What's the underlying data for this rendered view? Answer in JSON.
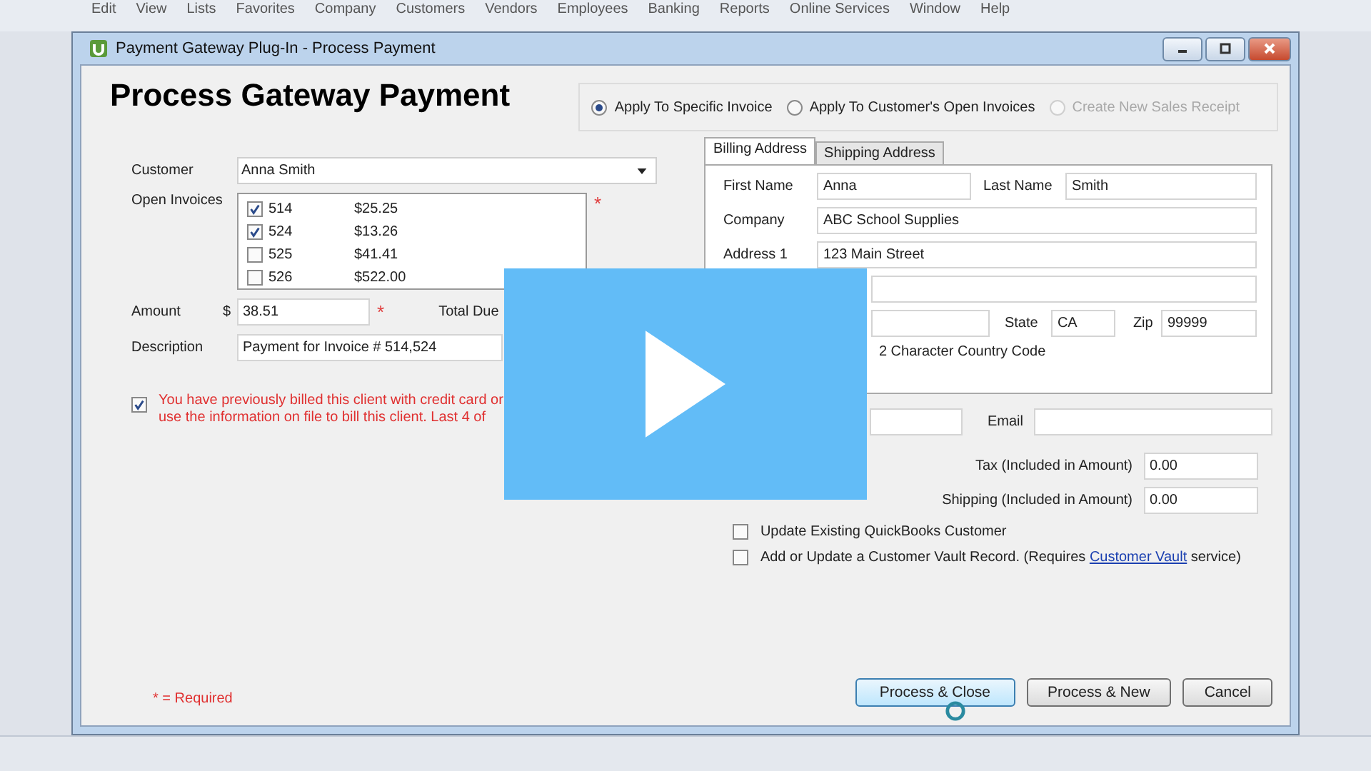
{
  "menu_bar": [
    "Edit",
    "View",
    "Lists",
    "Favorites",
    "Company",
    "Customers",
    "Vendors",
    "Employees",
    "Banking",
    "Reports",
    "Online Services",
    "Window",
    "Help"
  ],
  "window": {
    "title": "Payment Gateway Plug-In - Process Payment"
  },
  "heading": "Process Gateway Payment",
  "apply_options": [
    {
      "label": "Apply To Specific Invoice",
      "selected": true,
      "disabled": false
    },
    {
      "label": "Apply To Customer's Open Invoices",
      "selected": false,
      "disabled": false
    },
    {
      "label": "Create New Sales Receipt",
      "selected": false,
      "disabled": true
    }
  ],
  "customer": {
    "label": "Customer",
    "value": "Anna Smith"
  },
  "open_invoices": {
    "label": "Open Invoices",
    "required_mark": "*",
    "items": [
      {
        "number": "514",
        "amount": "$25.25",
        "checked": true
      },
      {
        "number": "524",
        "amount": "$13.26",
        "checked": true
      },
      {
        "number": "525",
        "amount": "$41.41",
        "checked": false
      },
      {
        "number": "526",
        "amount": "$522.00",
        "checked": false
      }
    ]
  },
  "amount": {
    "label": "Amount",
    "currency": "$",
    "value": "38.51",
    "required_mark": "*"
  },
  "total_due": {
    "label": "Total Due"
  },
  "description": {
    "label": "Description",
    "value": "Payment for Invoice # 514,524"
  },
  "stored_account_notice": {
    "checked": true,
    "text": "You have previously billed this client with credit card or\nuse the information on file to bill this client. Last 4 of"
  },
  "address_tabs": [
    {
      "label": "Billing Address",
      "selected": true
    },
    {
      "label": "Shipping Address",
      "selected": false
    }
  ],
  "billing": {
    "first_name": {
      "label": "First Name",
      "value": "Anna"
    },
    "last_name": {
      "label": "Last Name",
      "value": "Smith"
    },
    "company": {
      "label": "Company",
      "value": "ABC School Supplies"
    },
    "address_1": {
      "label": "Address 1",
      "value": "123 Main Street"
    },
    "state": {
      "label": "State",
      "value": "CA"
    },
    "zip": {
      "label": "Zip",
      "value": "99999"
    },
    "country": {
      "hint": "2 Character Country Code"
    }
  },
  "email": {
    "label": "Email"
  },
  "tax": {
    "label": "Tax (Included in Amount)",
    "value": "0.00"
  },
  "shipping": {
    "label": "Shipping (Included in Amount)",
    "value": "0.00"
  },
  "options": [
    {
      "kind": "plain",
      "label": "Update Existing QuickBooks Customer",
      "checked": false
    },
    {
      "kind": "link",
      "label": "Add or Update a Customer Vault Record.  (Requires",
      "link": "Customer Vault",
      "suffix": "service)",
      "checked": false
    }
  ],
  "required_note": "* = Required",
  "buttons": [
    {
      "label": "Process & Close",
      "default": true
    },
    {
      "label": "Process & New",
      "default": false
    },
    {
      "label": "Cancel",
      "default": false
    }
  ]
}
